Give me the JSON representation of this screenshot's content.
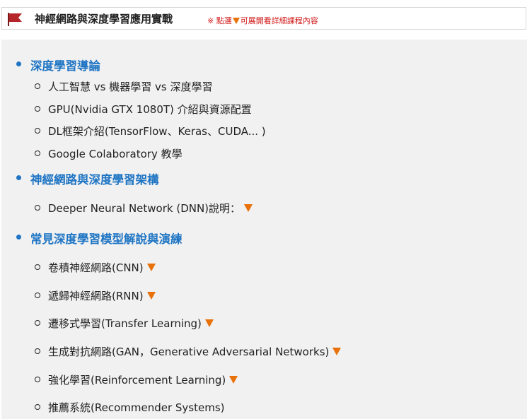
{
  "header": {
    "title": "神經網路與深度學習應用實戰",
    "hint_prefix": "※ 點選",
    "hint_suffix": "可展開看詳細課程內容",
    "accent_color": "#e8710a",
    "flag_color": "#b5252a",
    "hint_color": "#d21919"
  },
  "outline": {
    "link_color": "#1f75c4",
    "sections": [
      {
        "title": "深度學習導論",
        "items": [
          {
            "label": "人工智慧 vs 機器學習 vs 深度學習",
            "expandable": false
          },
          {
            "label": "GPU(Nvidia GTX 1080T) 介紹與資源配置",
            "expandable": false
          },
          {
            "label": "DL框架介紹(TensorFlow、Keras、CUDA... )",
            "expandable": false
          },
          {
            "label": "Google Colaboratory 教學",
            "expandable": false
          }
        ]
      },
      {
        "title": "神經網路與深度學習架構",
        "items": [
          {
            "label": "Deeper Neural Network (DNN)說明：",
            "expandable": true
          }
        ]
      },
      {
        "title": "常見深度學習模型解說與演練",
        "items": [
          {
            "label": "卷積神經網路(CNN)",
            "expandable": true
          },
          {
            "label": "遞歸神經網路(RNN)",
            "expandable": true
          },
          {
            "label": "遷移式學習(Transfer Learning)",
            "expandable": true
          },
          {
            "label": "生成對抗網路(GAN，Generative Adversarial Networks)",
            "expandable": true
          },
          {
            "label": "強化學習(Reinforcement Learning)",
            "expandable": true
          },
          {
            "label": "推薦系統(Recommender Systems)",
            "expandable": false
          }
        ]
      }
    ]
  }
}
